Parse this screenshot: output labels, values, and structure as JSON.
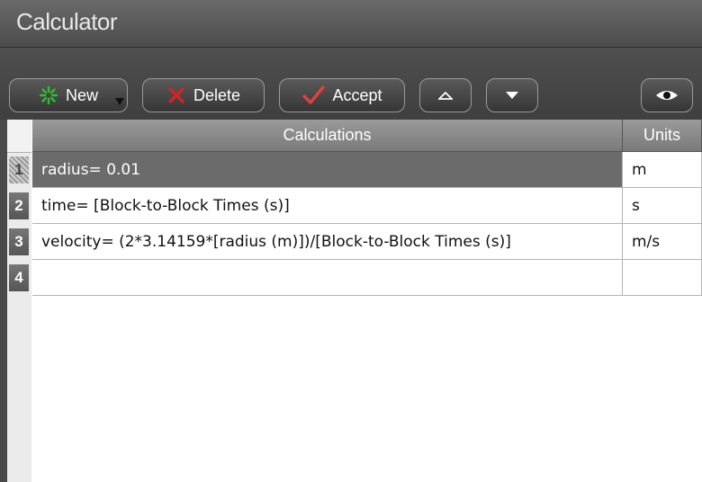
{
  "window": {
    "title": "Calculator"
  },
  "toolbar": {
    "new_label": "New",
    "delete_label": "Delete",
    "accept_label": "Accept"
  },
  "table": {
    "headers": {
      "calculations": "Calculations",
      "units": "Units"
    },
    "rows": [
      {
        "num": "1",
        "calc": "radius= 0.01",
        "units": "m"
      },
      {
        "num": "2",
        "calc": "time= [Block-to-Block Times (s)]",
        "units": "s"
      },
      {
        "num": "3",
        "calc": "velocity= (2*3.14159*[radius (m)])/[Block-to-Block Times (s)]",
        "units": "m/s"
      },
      {
        "num": "4",
        "calc": "",
        "units": ""
      }
    ],
    "selected_row": 1
  },
  "icons": {
    "new": "sparkle-icon",
    "new_menu": "dropdown-arrow-icon",
    "delete": "x-mark-icon",
    "accept": "checkmark-icon",
    "move_up": "chevron-up-icon",
    "move_down": "chevron-down-icon",
    "view": "eye-icon"
  },
  "colors": {
    "new_icon": "#2fbf2f",
    "delete_icon": "#e02020",
    "accept_icon": "#e04040",
    "selected_row": "#6b6b6b"
  }
}
